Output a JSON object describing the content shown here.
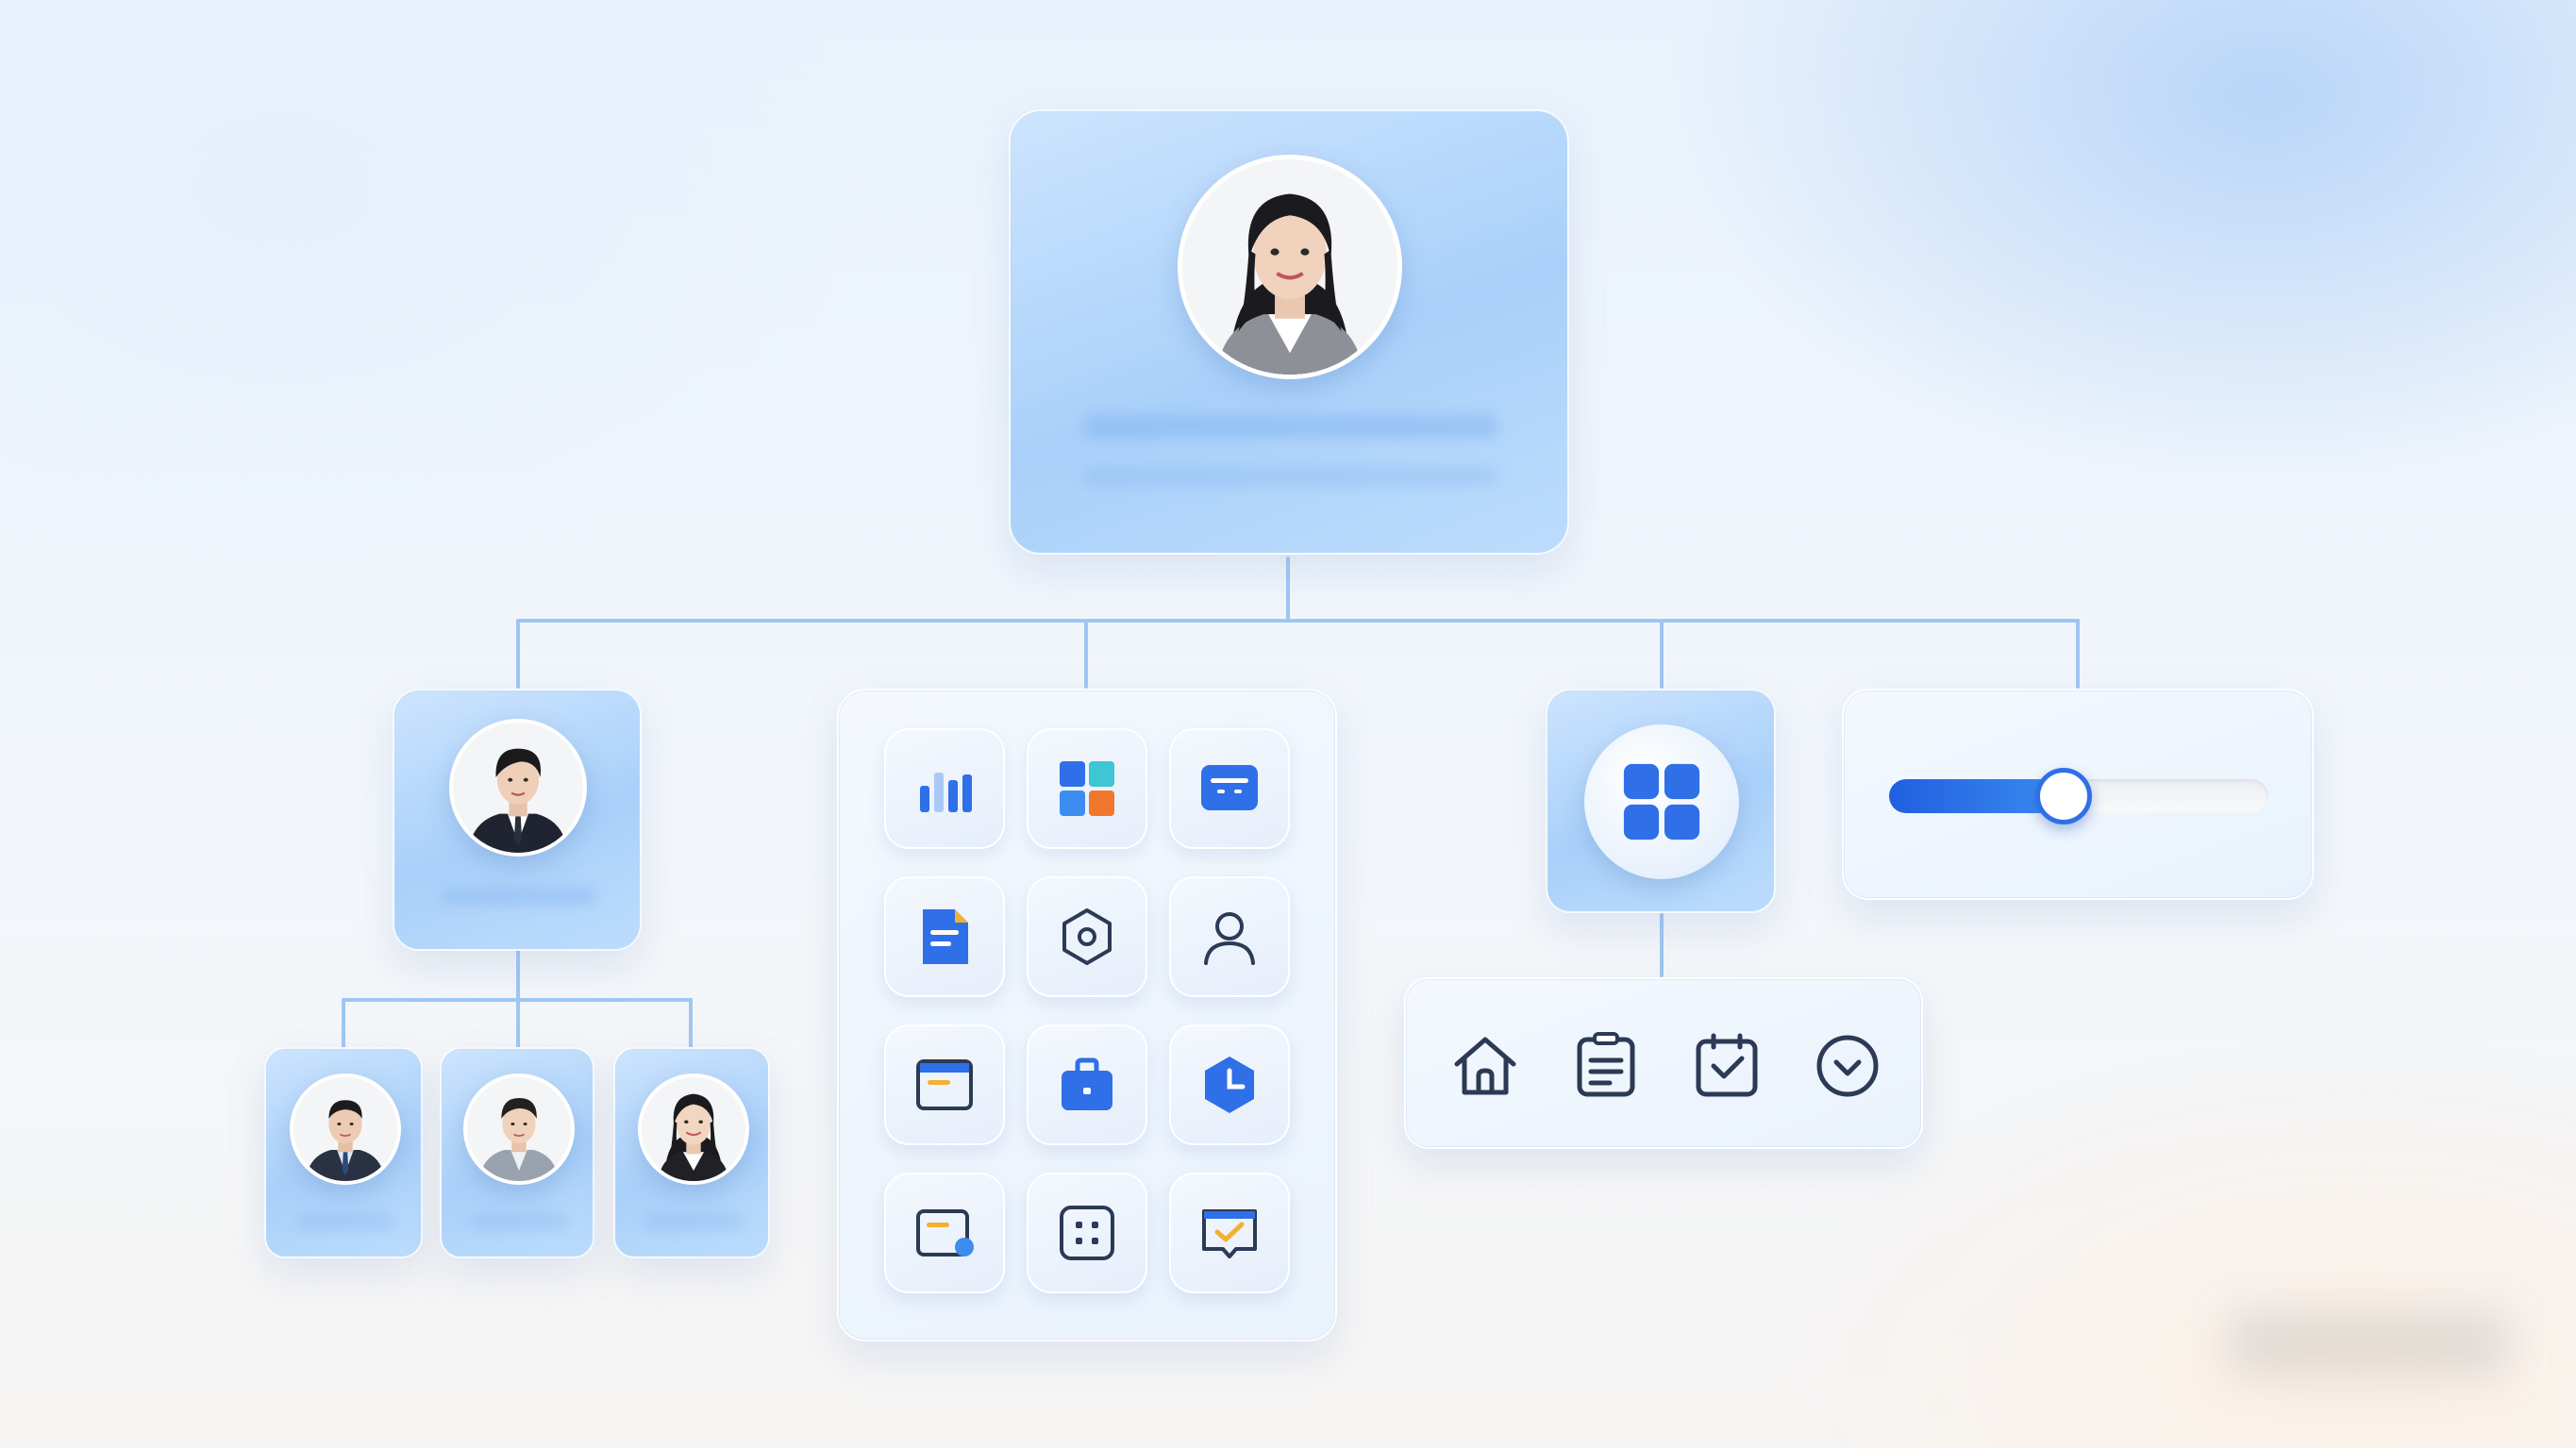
{
  "colors": {
    "accent": "#2f6fe8",
    "accent_light": "#3d8cf0",
    "connector": "#9fc6f3",
    "card_blue": "#aed2fa",
    "orange": "#f0782d",
    "teal": "#3ec6d4",
    "yellow": "#f2b134",
    "icon_dark": "#2b3a55"
  },
  "org_chart": {
    "top_person": {
      "avatar_icon": "woman-portrait",
      "name": "",
      "role": ""
    },
    "manager": {
      "avatar_icon": "man-portrait",
      "name": ""
    },
    "team": [
      {
        "avatar_icon": "man-portrait",
        "name": ""
      },
      {
        "avatar_icon": "man-portrait",
        "name": ""
      },
      {
        "avatar_icon": "woman-portrait",
        "name": ""
      }
    ]
  },
  "app_grid": {
    "icons": [
      "bar-chart-icon",
      "app-grid-icon",
      "message-icon",
      "document-icon",
      "settings-hexagon-icon",
      "user-icon",
      "calendar-window-icon",
      "briefcase-icon",
      "clock-icon",
      "card-icon",
      "dice-grid-icon",
      "checked-message-icon"
    ]
  },
  "apps_button": {
    "icon": "apps-icon"
  },
  "slider": {
    "value": 0.46
  },
  "nav_bar": {
    "icons": [
      "home-icon",
      "notes-icon",
      "calendar-check-icon",
      "chevron-down-circle-icon"
    ]
  }
}
